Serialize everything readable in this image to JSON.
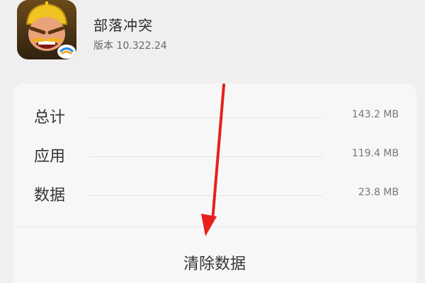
{
  "app": {
    "name": "部落冲突",
    "version": "版本 10.322.24",
    "icon": "clash-of-clans-app-icon"
  },
  "storage": {
    "rows": [
      {
        "label": "总计",
        "value": "143.2 MB"
      },
      {
        "label": "应用",
        "value": "119.4 MB"
      },
      {
        "label": "数据",
        "value": "23.8 MB"
      }
    ]
  },
  "actions": {
    "clear_data_label": "清除数据"
  },
  "annotation": {
    "arrow_color": "#e8201c"
  }
}
